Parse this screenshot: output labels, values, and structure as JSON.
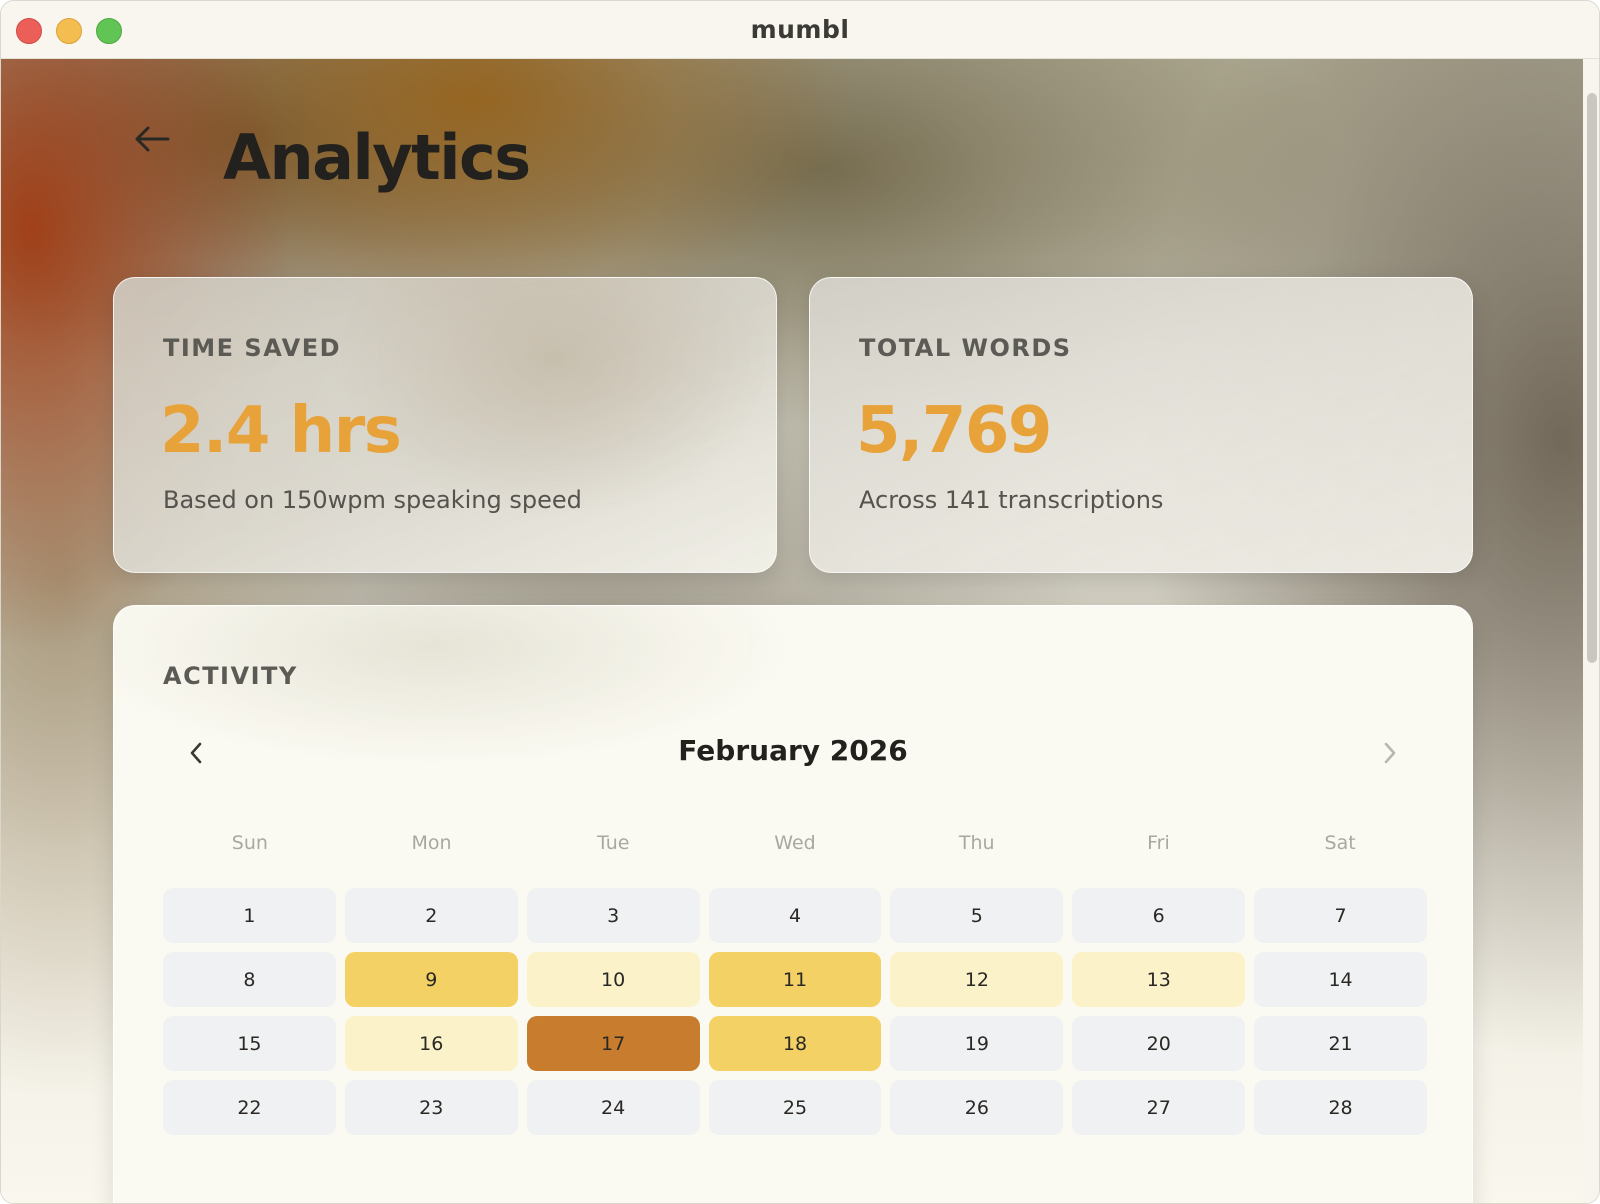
{
  "window": {
    "title": "mumbl"
  },
  "page": {
    "title": "Analytics"
  },
  "stats": {
    "time_saved": {
      "label": "TIME SAVED",
      "value": "2.4 hrs",
      "sub": "Based on 150wpm speaking speed"
    },
    "total_words": {
      "label": "TOTAL WORDS",
      "value": "5,769",
      "sub": "Across 141 transcriptions"
    }
  },
  "activity": {
    "label": "ACTIVITY",
    "month": "February 2026",
    "weekdays": [
      "Sun",
      "Mon",
      "Tue",
      "Wed",
      "Thu",
      "Fri",
      "Sat"
    ],
    "days": [
      {
        "n": "1",
        "level": 0
      },
      {
        "n": "2",
        "level": 0
      },
      {
        "n": "3",
        "level": 0
      },
      {
        "n": "4",
        "level": 0
      },
      {
        "n": "5",
        "level": 0
      },
      {
        "n": "6",
        "level": 0
      },
      {
        "n": "7",
        "level": 0
      },
      {
        "n": "8",
        "level": 0
      },
      {
        "n": "9",
        "level": 2
      },
      {
        "n": "10",
        "level": 1
      },
      {
        "n": "11",
        "level": 2
      },
      {
        "n": "12",
        "level": 1
      },
      {
        "n": "13",
        "level": 1
      },
      {
        "n": "14",
        "level": 0
      },
      {
        "n": "15",
        "level": 0
      },
      {
        "n": "16",
        "level": 1
      },
      {
        "n": "17",
        "level": 3
      },
      {
        "n": "18",
        "level": 2
      },
      {
        "n": "19",
        "level": 0
      },
      {
        "n": "20",
        "level": 0
      },
      {
        "n": "21",
        "level": 0
      },
      {
        "n": "22",
        "level": 0
      },
      {
        "n": "23",
        "level": 0
      },
      {
        "n": "24",
        "level": 0
      },
      {
        "n": "25",
        "level": 0
      },
      {
        "n": "26",
        "level": 0
      },
      {
        "n": "27",
        "level": 0
      },
      {
        "n": "28",
        "level": 0
      }
    ]
  },
  "colors": {
    "accent": "#e8a23a",
    "activity_levels": [
      "#f0f1f2",
      "#fbf2c9",
      "#f3d164",
      "#c87c2e"
    ]
  },
  "icons": {
    "back": "arrow-left-icon",
    "prev_month": "chevron-left-icon",
    "next_month": "chevron-right-icon"
  }
}
